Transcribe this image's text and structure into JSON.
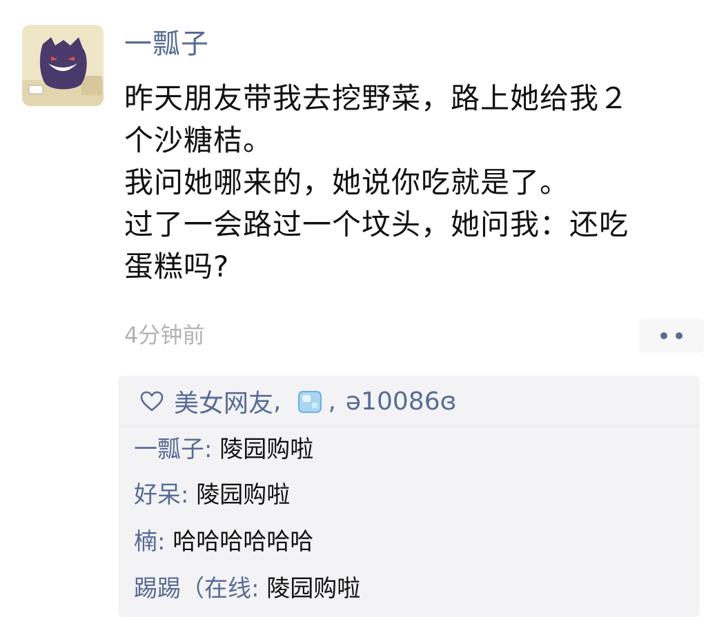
{
  "post": {
    "username": "一瓢子",
    "text_lines": [
      "昨天朋友带我去挖野菜，路上她给我２",
      "个沙糖桔。",
      "我问她哪来的，她说你吃就是了。",
      "过了一会路过一个坟头，她问我：还吃",
      "蛋糕吗?"
    ],
    "timestamp": "4分钟前",
    "more_icon": "two-dots-icon"
  },
  "likes": {
    "icon": "heart-outline-icon",
    "user1": "美女网友",
    "sep1": ",",
    "user2_icon": "ice-cube-emoji",
    "sep2": ",",
    "user3": "ə10086ɞ"
  },
  "comments": [
    {
      "author": "一瓢子",
      "colon": ":",
      "content": "陵园购啦"
    },
    {
      "author": "好呆",
      "colon": ":",
      "content": "陵园购啦"
    },
    {
      "author": "楠",
      "colon": ":",
      "content": "哈哈哈哈哈哈"
    },
    {
      "author": "踢踢（在线",
      "colon": ":",
      "content": "陵园购啦"
    }
  ],
  "colors": {
    "link": "#576b95",
    "text": "#111111",
    "muted": "#b2b2b2",
    "comment_bg": "#f3f3f5"
  }
}
